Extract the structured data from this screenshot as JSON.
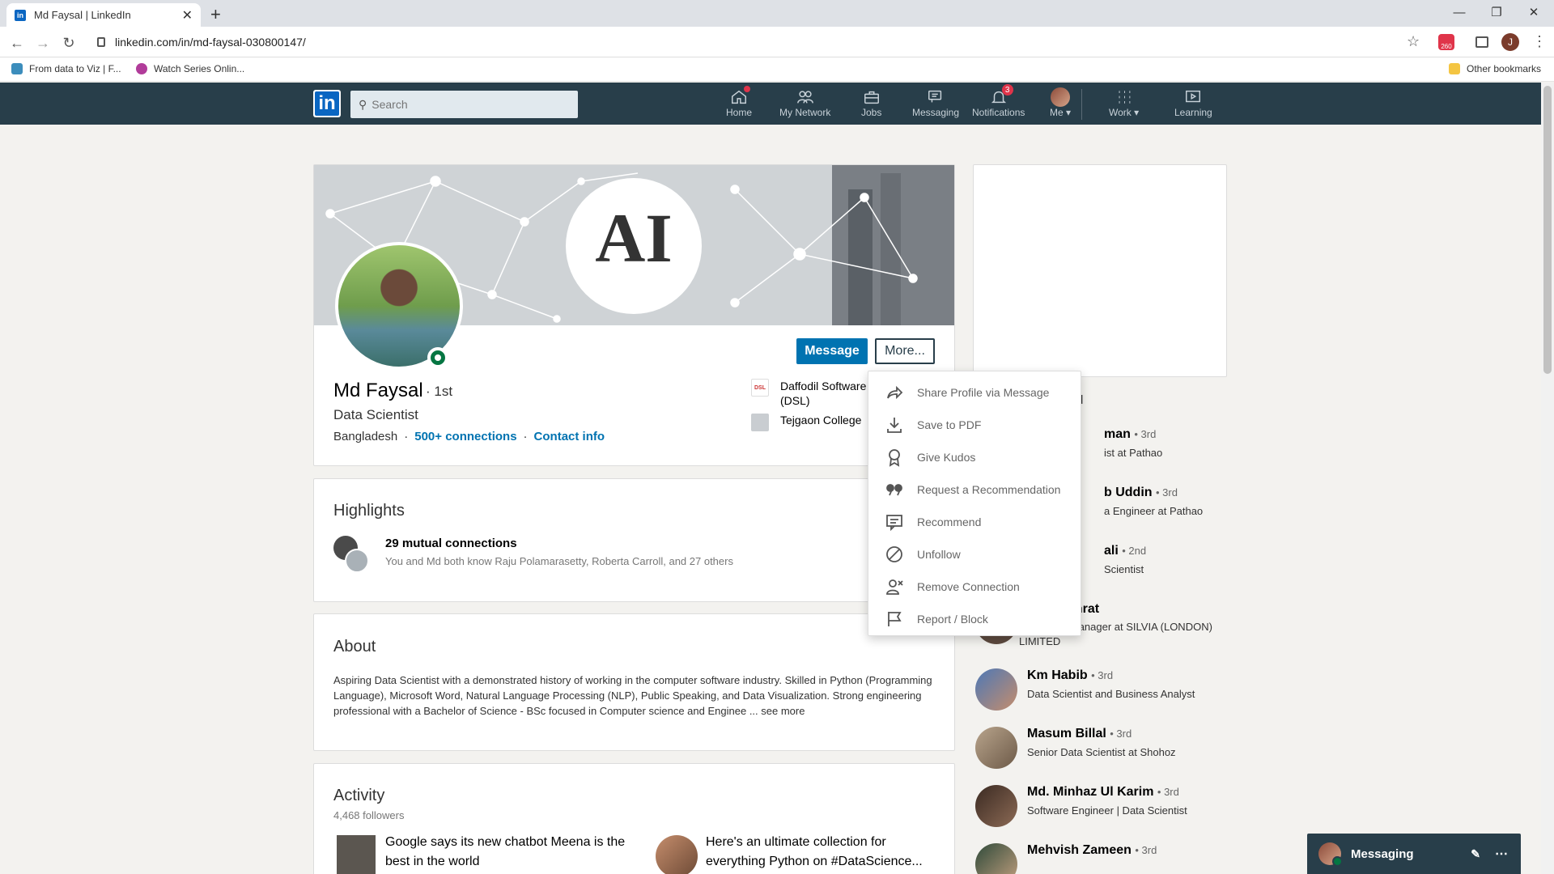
{
  "browser": {
    "tab_title": "Md Faysal | LinkedIn",
    "url": "linkedin.com/in/md-faysal-030800147/",
    "ext_badge": "260",
    "profile_initial": "J",
    "bookmarks": [
      "From data to Viz | F...",
      "Watch Series Onlin..."
    ],
    "other_bookmarks": "Other bookmarks"
  },
  "nav": {
    "search_placeholder": "Search",
    "items": [
      {
        "label": "Home",
        "icon": "home-icon",
        "badge": ""
      },
      {
        "label": "My Network",
        "icon": "network-icon",
        "badge": ""
      },
      {
        "label": "Jobs",
        "icon": "briefcase-icon",
        "badge": ""
      },
      {
        "label": "Messaging",
        "icon": "chat-icon",
        "badge": ""
      },
      {
        "label": "Notifications",
        "icon": "bell-icon",
        "badge": "3"
      },
      {
        "label": "Me",
        "icon": "avatar-icon",
        "badge": ""
      },
      {
        "label": "Work",
        "icon": "grid-icon",
        "badge": ""
      },
      {
        "label": "Learning",
        "icon": "play-icon",
        "badge": ""
      }
    ]
  },
  "profile": {
    "banner_text": "AI",
    "name": "Md Faysal",
    "degree": "· 1st",
    "headline": "Data Scientist",
    "location": "Bangladesh",
    "connections": "500+ connections",
    "contact": "Contact info",
    "message_btn": "Message",
    "more_btn": "More...",
    "experience": [
      "Daffodil Software",
      "(DSL)",
      "Tejgaon College"
    ],
    "exp_logo_text": "DSL"
  },
  "highlights": {
    "title": "Highlights",
    "mutual_title": "29 mutual connections",
    "mutual_detail": "You and Md both know Raju Polamarasetty, Roberta Carroll, and 27 others"
  },
  "about": {
    "title": "About",
    "text": "Aspiring Data Scientist with a demonstrated history of working in the computer software industry. Skilled in Python (Programming Language), Microsoft Word, Natural Language Processing (NLP), Public Speaking, and Data Visualization. Strong engineering professional with a Bachelor of Science - BSc focused in Computer science and Enginee",
    "see_more": "... see more"
  },
  "activity": {
    "title": "Activity",
    "followers": "4,468 followers",
    "posts": [
      "Google says its new chatbot Meena is the best in the world",
      "Here's an ultimate collection for everything Python on #DataScience..."
    ]
  },
  "dropdown": [
    {
      "label": "Share Profile via Message",
      "icon": "share-icon"
    },
    {
      "label": "Save to PDF",
      "icon": "download-icon"
    },
    {
      "label": "Give Kudos",
      "icon": "award-icon"
    },
    {
      "label": "Request a Recommendation",
      "icon": "quote-icon"
    },
    {
      "label": "Recommend",
      "icon": "message-icon"
    },
    {
      "label": "Unfollow",
      "icon": "block-icon"
    },
    {
      "label": "Remove Connection",
      "icon": "remove-user-icon"
    },
    {
      "label": "Report / Block",
      "icon": "flag-icon"
    }
  ],
  "right_rail": {
    "section_fragment": "d",
    "people": [
      {
        "name": "man",
        "degree": "• 3rd",
        "headline": "ist at Pathao"
      },
      {
        "name": "b Uddin",
        "degree": "• 3rd",
        "headline": "a Engineer at Pathao"
      },
      {
        "name": "ali",
        "degree": "• 2nd",
        "headline": "Scientist"
      },
      {
        "name": "shrat",
        "degree": "",
        "headline": "ompliance Manager at SILVIA (LONDON) LIMITED"
      },
      {
        "name": "Km Habib",
        "degree": "• 3rd",
        "headline": "Data Scientist and Business Analyst"
      },
      {
        "name": "Masum Billal",
        "degree": "• 3rd",
        "headline": "Senior Data Scientist at Shohoz"
      },
      {
        "name": "Md. Minhaz Ul Karim",
        "degree": "• 3rd",
        "headline": "Software Engineer | Data Scientist"
      },
      {
        "name": "Mehvish Zameen",
        "degree": "• 3rd",
        "headline": ""
      }
    ]
  },
  "messaging": {
    "label": "Messaging"
  },
  "colors": {
    "nav_bg": "#283e4a",
    "primary": "#0073b1",
    "online": "#057642",
    "badge": "#e0344a"
  }
}
